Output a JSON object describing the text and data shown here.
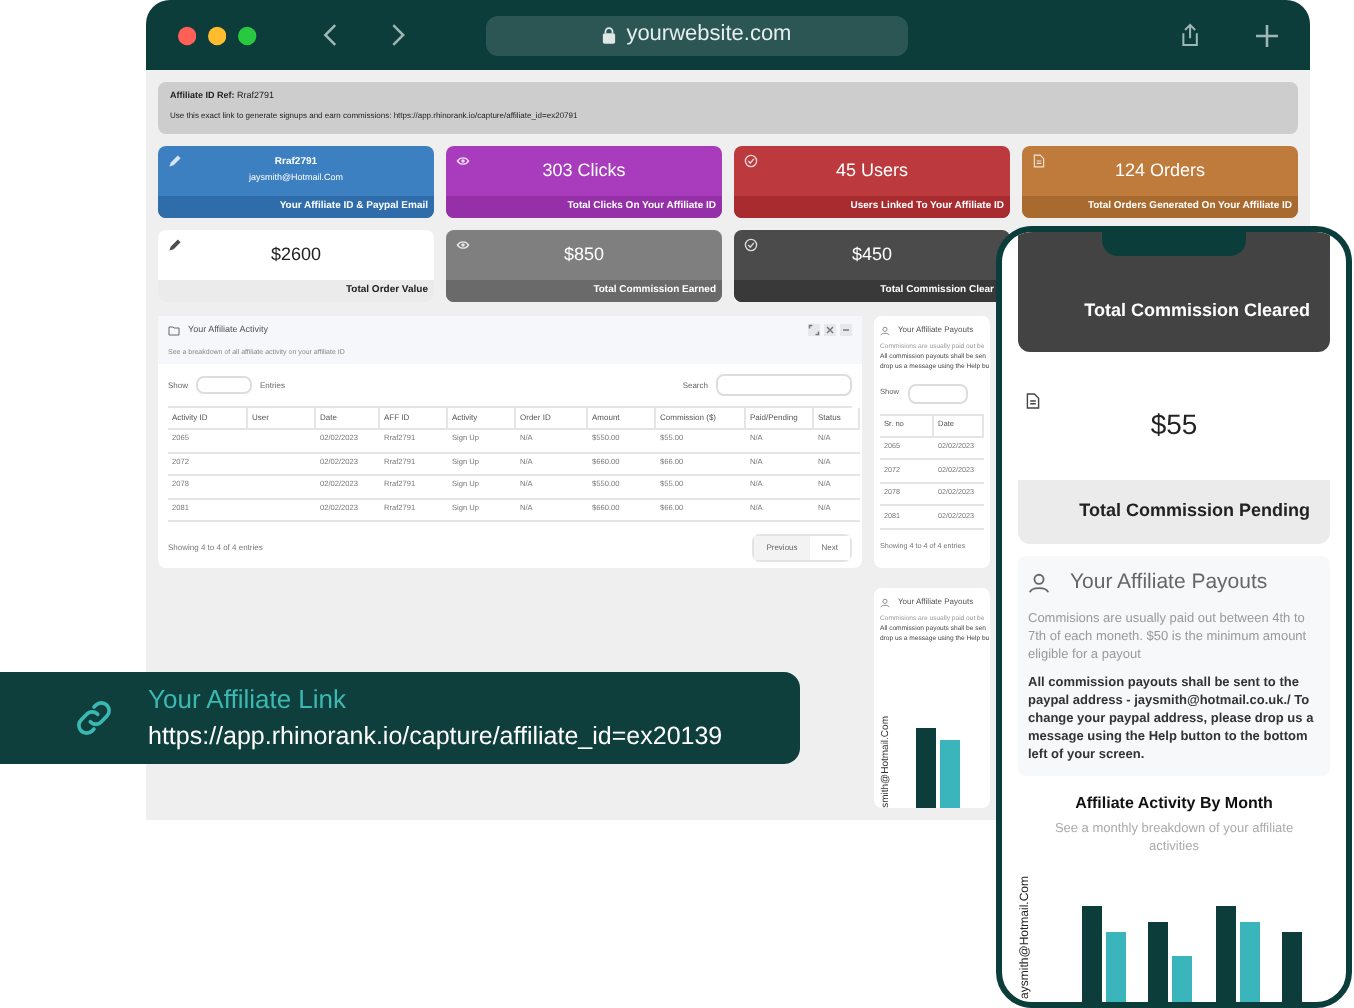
{
  "browser": {
    "address": "yourwebsite.com"
  },
  "affiliate_header": {
    "ref_label": "Affiliate ID Ref:",
    "ref_value": "Rraf2791",
    "note": "Use this exact link to generate signups and earn commissions: https://app.rhinorank.io/capture/affiliate_id=ex20791"
  },
  "stat_cards": [
    {
      "kind": "blue",
      "value": "Rraf2791",
      "sub": "jaysmith@Hotmail.Com",
      "caption": "Your Affiliate ID & Paypal Email"
    },
    {
      "kind": "purple",
      "value": "303 Clicks",
      "caption": "Total Clicks On Your Affiliate ID"
    },
    {
      "kind": "red",
      "value": "45 Users",
      "caption": "Users Linked To Your Affiliate ID"
    },
    {
      "kind": "orange",
      "value": "124 Orders",
      "caption": "Total Orders Generated On Your Affiliate ID"
    },
    {
      "kind": "light",
      "value": "$2600",
      "caption": "Total Order Value"
    },
    {
      "kind": "gray",
      "value": "$850",
      "caption": "Total Commission Earned"
    },
    {
      "kind": "dark",
      "value": "$450",
      "caption": "Total Commission Clear"
    }
  ],
  "activity": {
    "title": "Your Affiliate Activity",
    "subtitle": "See a breakdown of all affiliate activity on your affiliate ID",
    "show_label": "Show",
    "entries_label": "Entries",
    "search_label": "Search",
    "columns": [
      "Activity ID",
      "User",
      "Date",
      "AFF ID",
      "Activity",
      "Order ID",
      "Amount",
      "Commission ($)",
      "Paid/Pending",
      "Status"
    ],
    "rows": [
      [
        "2065",
        "",
        "02/02/2023",
        "Rraf2791",
        "Sign Up",
        "N/A",
        "$550.00",
        "$55.00",
        "N/A",
        "N/A"
      ],
      [
        "2072",
        "",
        "02/02/2023",
        "Rraf2791",
        "Sign Up",
        "N/A",
        "$660.00",
        "$66.00",
        "N/A",
        "N/A"
      ],
      [
        "2078",
        "",
        "02/02/2023",
        "Rraf2791",
        "Sign Up",
        "N/A",
        "$550.00",
        "$55.00",
        "N/A",
        "N/A"
      ],
      [
        "2081",
        "",
        "02/02/2023",
        "Rraf2791",
        "Sign Up",
        "N/A",
        "$660.00",
        "$66.00",
        "N/A",
        "N/A"
      ]
    ],
    "footer": "Showing 4 to 4 of 4 entries",
    "buttons": [
      "Previous",
      "Next"
    ]
  },
  "payouts_panel": {
    "title": "Your Affiliate Payouts",
    "lines": [
      "Commisions are usually paid out be",
      "All commission payouts shall be sen",
      "drop us a message using the Help bu"
    ],
    "show_label": "Show",
    "columns": [
      "Sr. no",
      "Date"
    ],
    "rows": [
      [
        "2065",
        "02/02/2023"
      ],
      [
        "2072",
        "02/02/2023"
      ],
      [
        "2078",
        "02/02/2023"
      ],
      [
        "2081",
        "02/02/2023"
      ]
    ],
    "footer": "Showing 4 to 4 of 4 entries"
  },
  "payouts_chart_panel": {
    "title": "Your Affiliate Payouts",
    "lines": [
      "Commisions are usually paid out be",
      "All commission payouts shall be sen",
      "drop us a message using the Help bu"
    ],
    "axis_label": "smith@Hotmail.Com"
  },
  "phone": {
    "cleared_caption": "Total Commission Cleared",
    "pending_value": "$55",
    "pending_caption": "Total Commission Pending",
    "payouts_title": "Your Affiliate Payouts",
    "payouts_note": "Commisions are usually paid out between 4th to 7th of each moneth. $50 is the minimum amount eligible for a payout",
    "payouts_info": "All commission payouts shall be sent to the paypal address - jaysmith@hotmail.co.uk./ To change your paypal address, please drop us a message using the Help button to the bottom left of your screen.",
    "chart_title": "Affiliate Activity By Month",
    "chart_subtitle": "See a monthly breakdown of your affiliate activities",
    "axis_label": "aysmith@Hotmail.Com"
  },
  "link_card": {
    "title": "Your Affiliate Link",
    "url": "https://app.rhinorank.io/capture/affiliate_id=ex20139"
  }
}
